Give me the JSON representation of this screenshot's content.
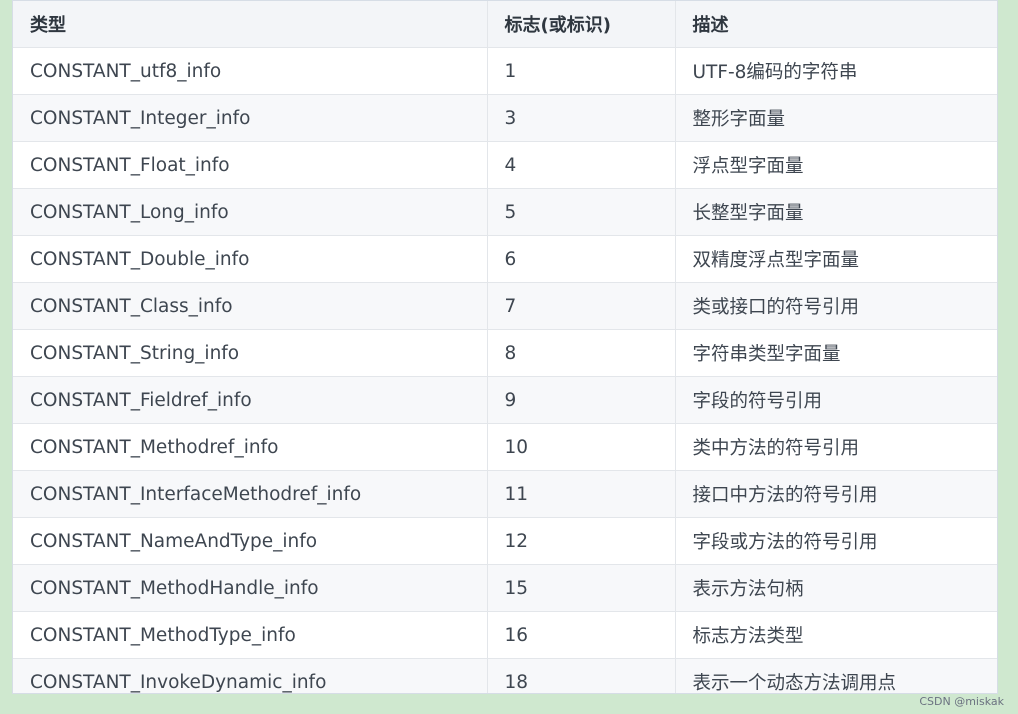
{
  "table": {
    "headers": [
      "类型",
      "标志(或标识)",
      "描述"
    ],
    "rows": [
      [
        "CONSTANT_utf8_info",
        "1",
        "UTF-8编码的字符串"
      ],
      [
        "CONSTANT_Integer_info",
        "3",
        "整形字面量"
      ],
      [
        "CONSTANT_Float_info",
        "4",
        "浮点型字面量"
      ],
      [
        "CONSTANT_Long_info",
        "5",
        "长整型字面量"
      ],
      [
        "CONSTANT_Double_info",
        "6",
        "双精度浮点型字面量"
      ],
      [
        "CONSTANT_Class_info",
        "7",
        "类或接口的符号引用"
      ],
      [
        "CONSTANT_String_info",
        "8",
        "字符串类型字面量"
      ],
      [
        "CONSTANT_Fieldref_info",
        "9",
        "字段的符号引用"
      ],
      [
        "CONSTANT_Methodref_info",
        "10",
        "类中方法的符号引用"
      ],
      [
        "CONSTANT_InterfaceMethodref_info",
        "11",
        "接口中方法的符号引用"
      ],
      [
        "CONSTANT_NameAndType_info",
        "12",
        "字段或方法的符号引用"
      ],
      [
        "CONSTANT_MethodHandle_info",
        "15",
        "表示方法句柄"
      ],
      [
        "CONSTANT_MethodType_info",
        "16",
        "标志方法类型"
      ],
      [
        "CONSTANT_InvokeDynamic_info",
        "18",
        "表示一个动态方法调用点"
      ]
    ]
  },
  "watermark": "CSDN @miskak",
  "colors": {
    "page_background": "#cfe8cf",
    "header_background": "#f3f5f8",
    "striped_row": "#f7f8fa",
    "text": "#3e4650",
    "border": "#e3e6ea"
  }
}
